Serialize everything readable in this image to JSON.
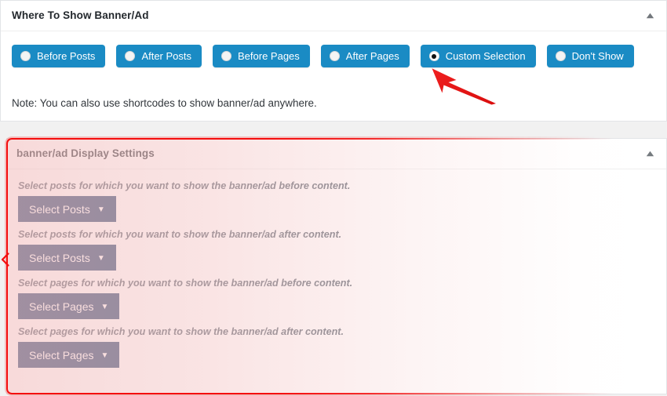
{
  "panels": [
    {
      "id": "where-to-show",
      "title": "Where To Show Banner/Ad",
      "toggle_icon": "triangle-up-icon",
      "note": "Note: You can also use shortcodes to show banner/ad anywhere.",
      "options": [
        {
          "label": "Before Posts",
          "selected": false,
          "icon": "radio-unchecked-icon"
        },
        {
          "label": "After Posts",
          "selected": false,
          "icon": "radio-unchecked-icon"
        },
        {
          "label": "Before Pages",
          "selected": false,
          "icon": "radio-unchecked-icon"
        },
        {
          "label": "After Pages",
          "selected": false,
          "icon": "radio-unchecked-icon"
        },
        {
          "label": "Custom Selection",
          "selected": true,
          "icon": "radio-checked-icon"
        },
        {
          "label": "Don't Show",
          "selected": false,
          "icon": "radio-unchecked-icon"
        }
      ]
    },
    {
      "id": "display-settings",
      "title": "banner/ad Display Settings",
      "toggle_icon": "triangle-up-icon",
      "fields": [
        {
          "label": "Select posts for which you want to show the banner/ad before content.",
          "button": "Select Posts",
          "caret": "▼"
        },
        {
          "label": "Select posts for which you want to show the banner/ad after content.",
          "button": "Select Posts",
          "caret": "▼"
        },
        {
          "label": "Select pages for which you want to show the banner/ad before content.",
          "button": "Select Pages",
          "caret": "▼"
        },
        {
          "label": "Select pages for which you want to show the banner/ad after content.",
          "button": "Select Pages",
          "caret": "▼"
        }
      ]
    }
  ],
  "annotations": {
    "arrow": {
      "name": "red-pointer-arrow",
      "target": "Custom Selection",
      "color": "#ee1b1b"
    },
    "highlight": {
      "name": "red-highlight-frame",
      "target": "banner/ad Display Settings",
      "color": "#f40d0d"
    },
    "edge_marker": {
      "name": "red-left-edge-marker",
      "color": "#f40d0d"
    }
  },
  "colors": {
    "radio_button_blue": "#1a8bc4",
    "select_button_navy": "#1d3c69",
    "panel_border": "#e2e4e7",
    "page_background": "#f1f1f1",
    "title_text": "#23282d",
    "label_text": "#4f5964",
    "annotation_red": "#f40d0d"
  }
}
